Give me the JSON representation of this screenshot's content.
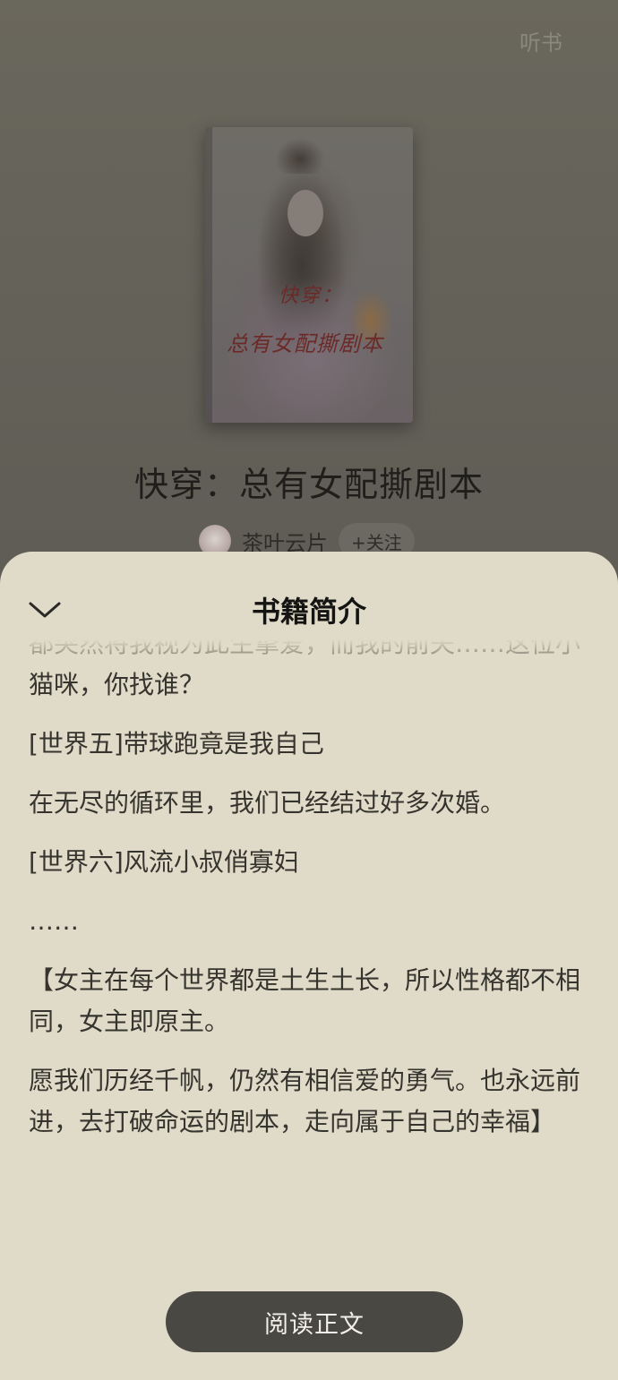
{
  "header": {
    "listen_label": "听书"
  },
  "book": {
    "cover_text_line1": "快穿：",
    "cover_text_line2": "总有女配撕剧本",
    "title": "快穿：总有女配撕剧本",
    "author": "茶叶云片",
    "follow_label": "+关注"
  },
  "sheet": {
    "title": "书籍简介",
    "paragraphs": [
      "都突然将我视为此生挚爱，而我的前夫……这位小猫咪，你找谁？",
      "[世界五]带球跑竟是我自己",
      "在无尽的循环里，我们已经结过好多次婚。",
      "[世界六]风流小叔俏寡妇",
      "……",
      "【女主在每个世界都是土生土长，所以性格都不相同，女主即原主。",
      "愿我们历经千帆，仍然有相信爱的勇气。也永远前进，去打破命运的剧本，走向属于自己的幸福】"
    ],
    "read_button_label": "阅读正文"
  },
  "colors": {
    "overlay_bg": "#5f5d55",
    "sheet_bg": "#e0dbc8",
    "button_bg": "#4a4843",
    "cover_title_color": "#6b2a28"
  },
  "icons": {
    "collapse": "chevron-down-icon"
  }
}
